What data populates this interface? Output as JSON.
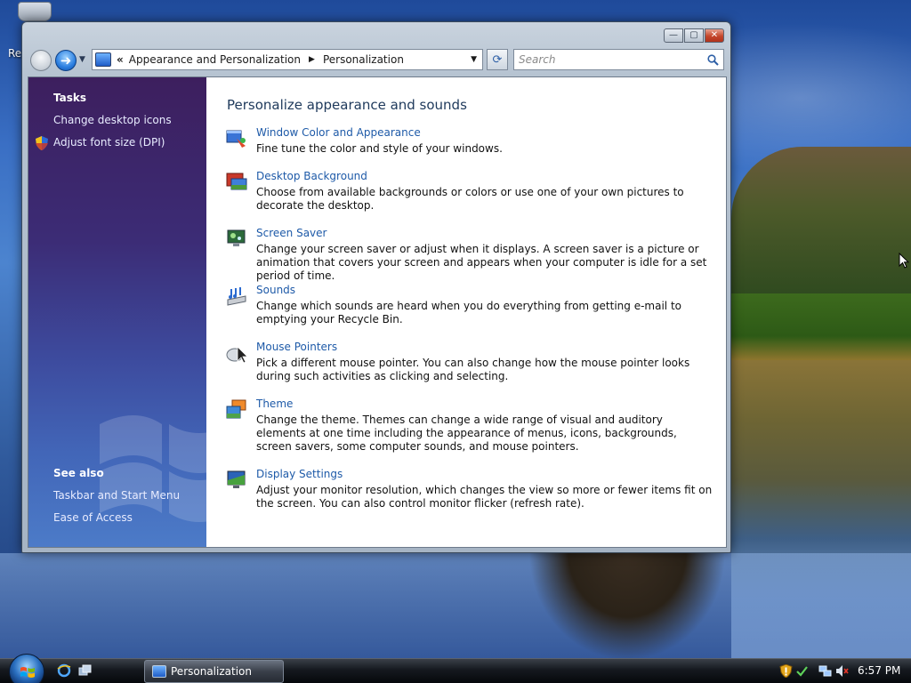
{
  "desktop": {
    "icon_label": "Re"
  },
  "window": {
    "title": "Personalization",
    "controls": {
      "minimize": "—",
      "maximize": "▢",
      "close": "✕"
    }
  },
  "navbar": {
    "address_prefix": "«",
    "breadcrumb": [
      "Appearance and Personalization",
      "Personalization"
    ],
    "breadcrumb_separator": "▶",
    "dropdown_arrow": "▼",
    "refresh_icon": "⟳",
    "search_placeholder": "Search"
  },
  "tasks": {
    "heading": "Tasks",
    "items": [
      "Change desktop icons",
      "Adjust font size (DPI)"
    ]
  },
  "see_also": {
    "heading": "See also",
    "items": [
      "Taskbar and Start Menu",
      "Ease of Access"
    ]
  },
  "main": {
    "title": "Personalize appearance and sounds",
    "items": [
      {
        "title": "Window Color and Appearance",
        "desc": "Fine tune the color and style of your windows.",
        "icon": "window-color-icon"
      },
      {
        "title": "Desktop Background",
        "desc": "Choose from available backgrounds or colors or use one of your own pictures to decorate the desktop.",
        "icon": "desktop-background-icon"
      },
      {
        "title": "Screen Saver",
        "desc": "Change your screen saver or adjust when it displays. A screen saver is a picture or animation that covers your screen and appears when your computer is idle for a set period of time.",
        "icon": "screen-saver-icon"
      },
      {
        "title": "Sounds",
        "desc": "Change which sounds are heard when you do everything from getting e-mail to emptying your Recycle Bin.",
        "icon": "sounds-icon"
      },
      {
        "title": "Mouse Pointers",
        "desc": "Pick a different mouse pointer. You can also change how the mouse pointer looks during such activities as clicking and selecting.",
        "icon": "mouse-pointers-icon"
      },
      {
        "title": "Theme",
        "desc": "Change the theme. Themes can change a wide range of visual and auditory elements at one time including the appearance of menus, icons, backgrounds, screen savers, some computer sounds, and mouse pointers.",
        "icon": "theme-icon"
      },
      {
        "title": "Display Settings",
        "desc": "Adjust your monitor resolution, which changes the view so more or fewer items fit on the screen. You can also control monitor flicker (refresh rate).",
        "icon": "display-settings-icon"
      }
    ]
  },
  "taskbar": {
    "task_label": "Personalization",
    "clock": "6:57 PM"
  }
}
